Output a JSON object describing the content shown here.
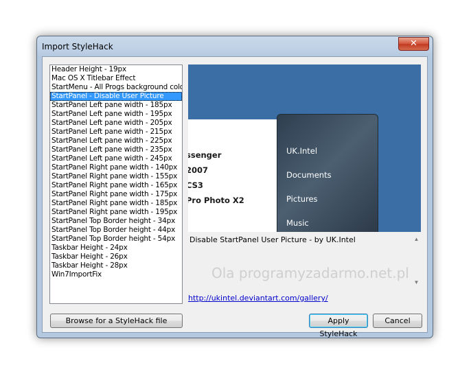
{
  "window": {
    "title": "Import StyleHack",
    "close_glyph": "✕"
  },
  "list": {
    "items": [
      "Header Height - 19px",
      "Mac OS X Titlebar Effect",
      "StartMenu - All Progs background color",
      "StartPanel - Disable User Picture",
      "StartPanel Left pane width - 185px",
      "StartPanel Left pane width - 195px",
      "StartPanel Left pane width - 205px",
      "StartPanel Left pane width - 215px",
      "StartPanel Left pane width - 225px",
      "StartPanel Left pane width - 235px",
      "StartPanel Left pane width - 245px",
      "StartPanel Right pane width - 140px",
      "StartPanel Right pane width - 155px",
      "StartPanel Right pane width - 165px",
      "StartPanel Right pane width - 175px",
      "StartPanel Right pane width - 185px",
      "StartPanel Right pane width - 195px",
      "StartPanel Top Border height - 34px",
      "StartPanel Top Border height - 44px",
      "StartPanel Top Border height - 54px",
      "Taskbar Height - 24px",
      "Taskbar Height - 26px",
      "Taskbar Height - 28px",
      "Win7ImportFix"
    ],
    "selected_index": 3
  },
  "preview": {
    "left_items": [
      "ssenger",
      "2007",
      "CS3",
      "Pro Photo X2"
    ],
    "right_items": [
      "UK.Intel",
      "Documents",
      "Pictures",
      "Music"
    ]
  },
  "description": "Disable StartPanel User Picture - by UK.Intel",
  "watermark": "Ola programyzadarmo.net.pl",
  "link": "http://ukintel.deviantart.com/gallery/",
  "buttons": {
    "browse": "Browse for a StyleHack file",
    "apply": "Apply StyleHack",
    "cancel": "Cancel"
  },
  "colors": {
    "selection": "#3399ff",
    "preview_bg": "#3a6ea5",
    "link": "#0000cc"
  }
}
